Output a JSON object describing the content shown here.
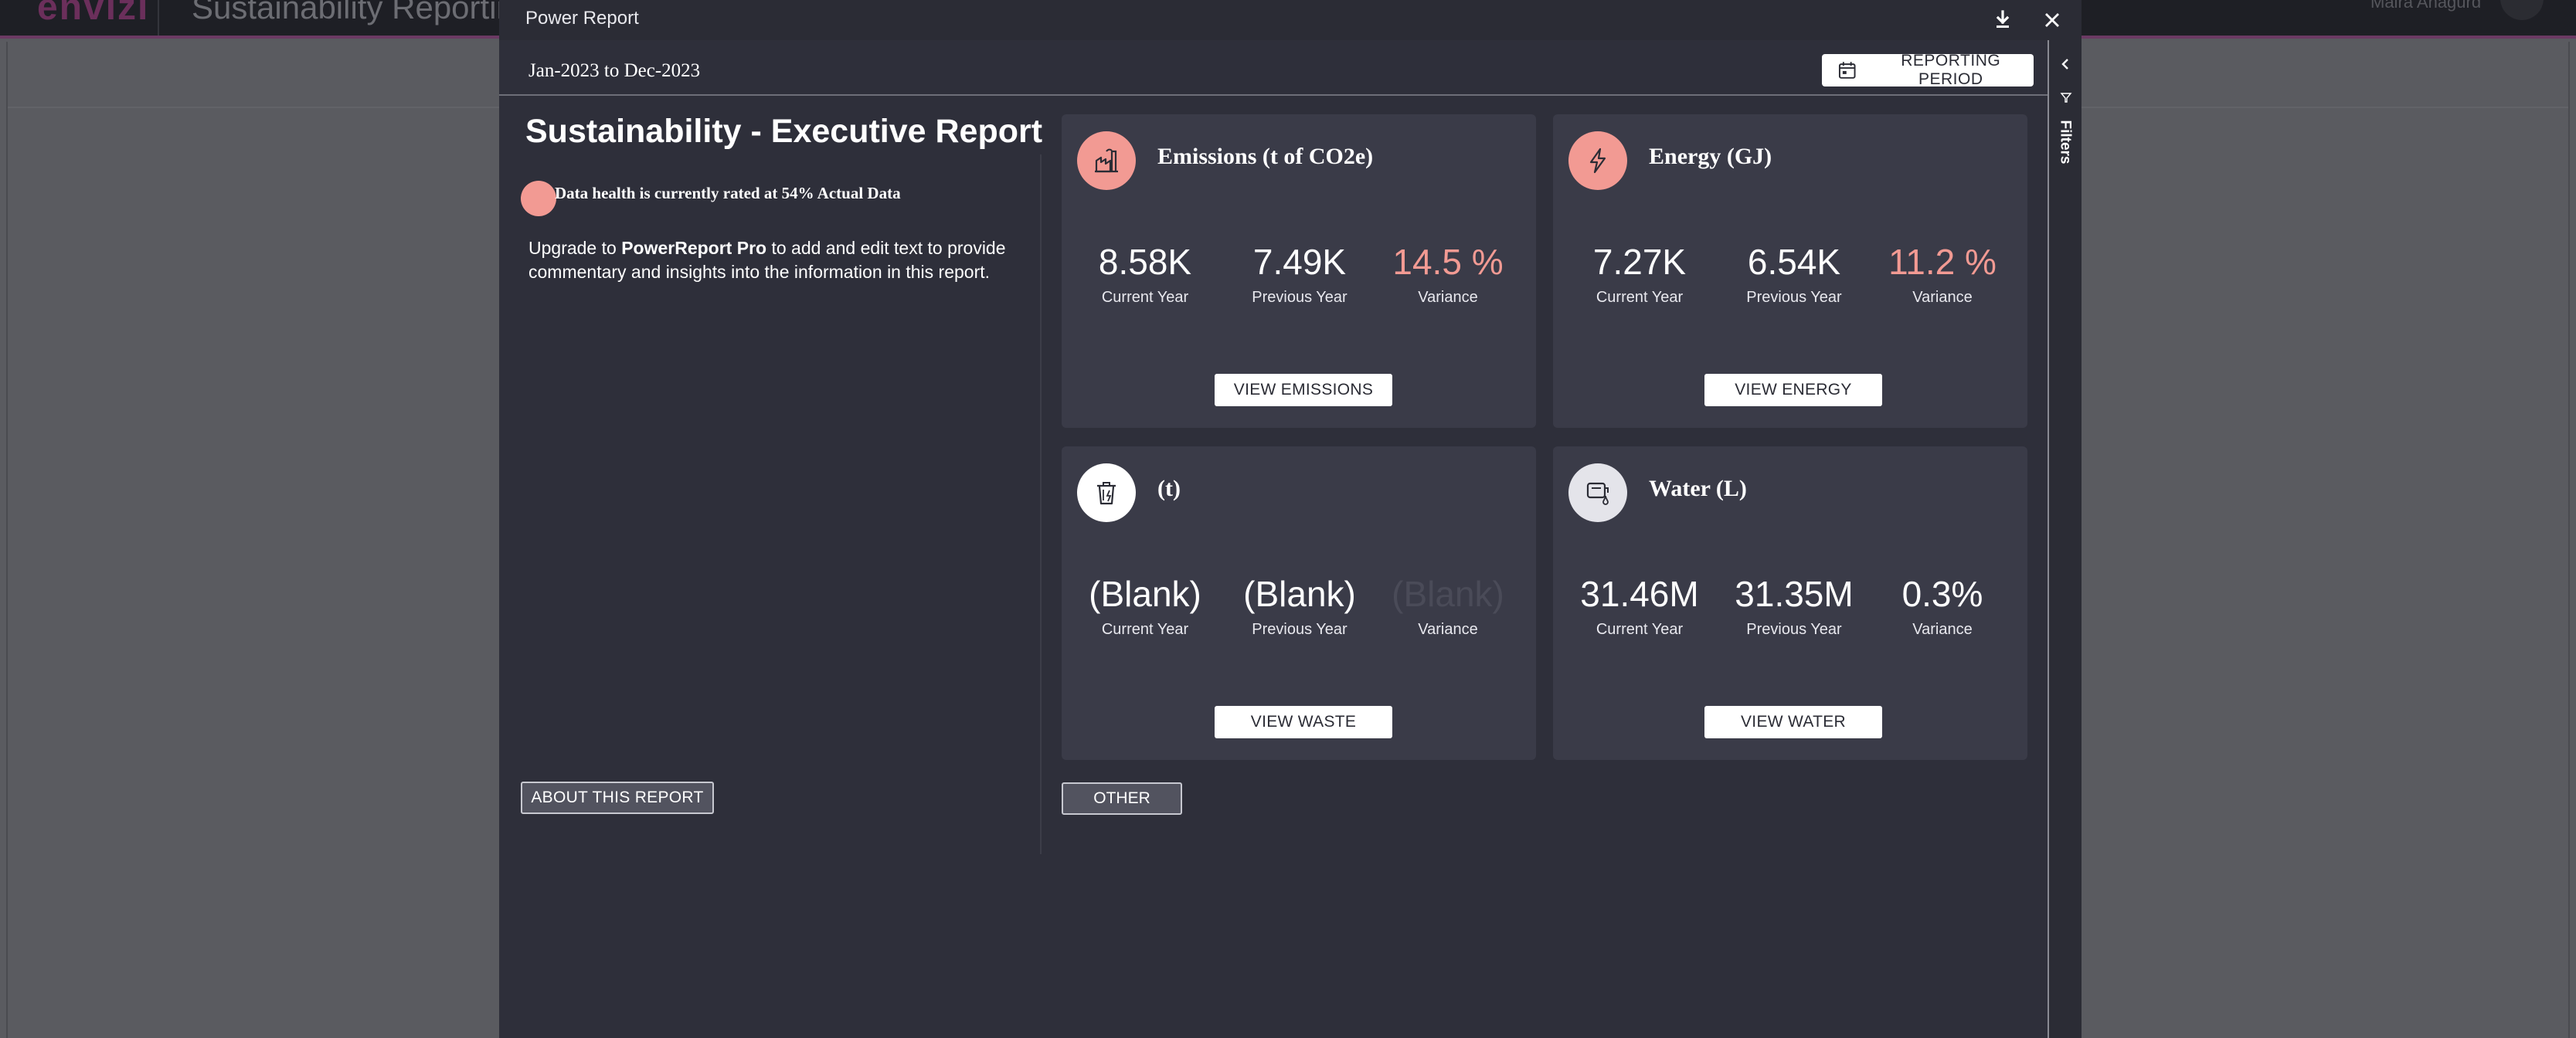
{
  "background": {
    "logo": "envizi",
    "title": "Sustainability Reporting Ma",
    "user": "Malra Anagurd"
  },
  "modal": {
    "title": "Power Report",
    "download_icon": "download-icon",
    "close_icon": "close-icon"
  },
  "period": {
    "range": "Jan-2023 to Dec-2023",
    "button_label": "REPORTING PERIOD",
    "button_icon": "calendar-icon"
  },
  "filters": {
    "label": "Filters",
    "icon": "funnel-icon"
  },
  "report": {
    "title": "Sustainability - Executive Report",
    "health_text": "Data health is currently rated at 54% Actual Data",
    "health_color": "#f29a93",
    "upgrade_prefix": "Upgrade to ",
    "upgrade_product": "PowerReport Pro",
    "upgrade_suffix": " to add and edit text to provide commentary and insights into the information in this report.",
    "about_button": "ABOUT THIS REPORT",
    "other_button": "OTHER"
  },
  "cards": {
    "emissions": {
      "title": "Emissions (t of CO2e)",
      "icon": "factory-icon",
      "icon_bg": "#f29a93",
      "current_value": "8.58K",
      "current_label": "Current Year",
      "previous_value": "7.49K",
      "previous_label": "Previous Year",
      "variance_value": "14.5 %",
      "variance_label": "Variance",
      "variance_color": "#f29a93",
      "button": "VIEW EMISSIONS"
    },
    "energy": {
      "title": "Energy (GJ)",
      "icon": "lightning-icon",
      "icon_bg": "#f29a93",
      "current_value": "7.27K",
      "current_label": "Current Year",
      "previous_value": "6.54K",
      "previous_label": "Previous Year",
      "variance_value": "11.2 %",
      "variance_label": "Variance",
      "variance_color": "#f29a93",
      "button": "VIEW ENERGY"
    },
    "waste": {
      "title": "(t)",
      "icon": "trash-bin-icon",
      "icon_bg": "#ffffff",
      "current_value": "(Blank)",
      "current_label": "Current Year",
      "previous_value": "(Blank)",
      "previous_label": "Previous Year",
      "variance_value": "(Blank)",
      "variance_label": "Variance",
      "variance_color": "#4a4b58",
      "button": "VIEW WASTE"
    },
    "water": {
      "title": "Water (L)",
      "icon": "water-meter-icon",
      "icon_bg": "#e4e4ea",
      "current_value": "31.46M",
      "current_label": "Current Year",
      "previous_value": "31.35M",
      "previous_label": "Previous Year",
      "variance_value": "0.3%",
      "variance_label": "Variance",
      "variance_color": "#ffffff",
      "button": "VIEW WATER"
    }
  }
}
